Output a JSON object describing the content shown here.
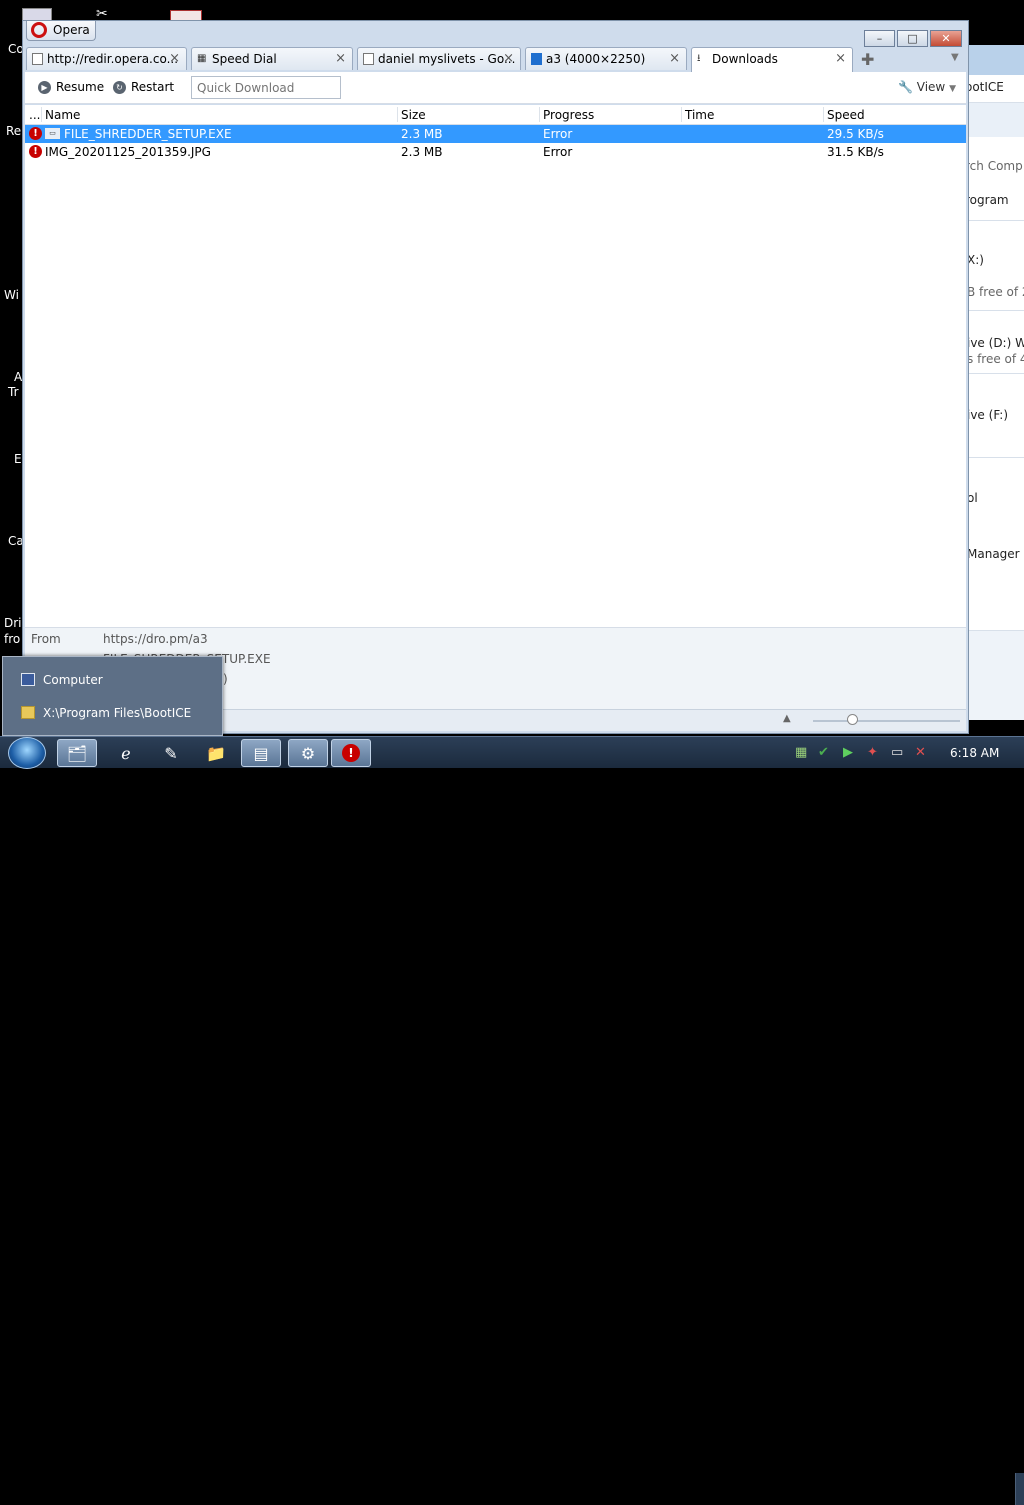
{
  "desktop": {
    "labels": [
      "Co",
      "Re",
      "Wi",
      "A",
      "Tr",
      "E",
      "Ca",
      "Dri",
      "fro"
    ]
  },
  "background_window": {
    "title_fragment": "ootICE",
    "search_fragment": "rch Comp",
    "program_fragment": "rogram",
    "items": [
      {
        "name": "X:)",
        "detail": "B free of 2!"
      },
      {
        "name": "ive (D:) WI",
        "detail": "s free of 46"
      },
      {
        "name": "ive (F:)",
        "detail": ""
      },
      {
        "name": "ol",
        "detail": ""
      },
      {
        "name": "Manager",
        "detail": ""
      }
    ]
  },
  "browser": {
    "app_name": "Opera",
    "window_controls": {
      "minimize": "–",
      "maximize": "□",
      "close": "✕"
    },
    "tabs": [
      {
        "label": "http://redir.opera.co...",
        "icon": "page-icon",
        "active": false
      },
      {
        "label": "Speed Dial",
        "icon": "speed-dial-icon",
        "active": false
      },
      {
        "label": "daniel myslivets - Go...",
        "icon": "page-icon",
        "active": false
      },
      {
        "label": "a3 (4000×2250)",
        "icon": "image-icon",
        "active": false
      },
      {
        "label": "Downloads",
        "icon": "download-icon",
        "active": true
      }
    ],
    "toolbar": {
      "resume_label": "Resume",
      "restart_label": "Restart",
      "quick_download_placeholder": "Quick Download",
      "view_label": "View"
    },
    "columns": [
      "...",
      "Name",
      "Size",
      "Progress",
      "Time",
      "Speed"
    ],
    "downloads": [
      {
        "name": "FILE_SHREDDER_SETUP.EXE",
        "size": "2.3 MB",
        "progress": "Error",
        "time": "",
        "speed": "29.5 KB/s",
        "selected": true
      },
      {
        "name": "IMG_20201125_201359.JPG",
        "size": "2.3 MB",
        "progress": "Error",
        "time": "",
        "speed": "31.5 KB/s",
        "selected": false
      }
    ],
    "details": {
      "from_label": "From",
      "from_value": "https://dro.pm/a3",
      "to_value": "FILE_SHREDDER_SETUP.EXE",
      "extra_value": ")"
    }
  },
  "jump_list": {
    "items": [
      {
        "label": "Computer",
        "icon": "computer-icon"
      },
      {
        "label": "X:\\Program Files\\BootICE",
        "icon": "folder-icon"
      }
    ]
  },
  "taskbar": {
    "clock": "6:18 AM",
    "apps": [
      "explorer-icon",
      "ie-icon",
      "paint-icon",
      "folder-icon",
      "app-icon",
      "settings-icon",
      "opera-icon"
    ]
  },
  "colors": {
    "selection": "#3399ff",
    "error": "#c80000"
  }
}
